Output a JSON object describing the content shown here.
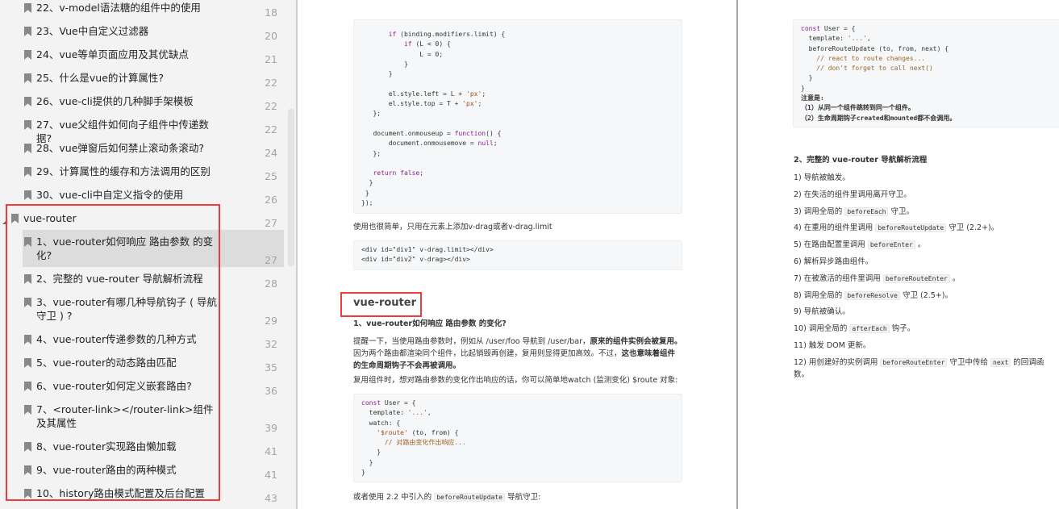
{
  "sidebar": {
    "items": [
      {
        "label": "22、v-model语法糖的组件中的使用",
        "page": "18"
      },
      {
        "label": "23、Vue中自定义过滤器",
        "page": "20"
      },
      {
        "label": "24、vue等单页面应用及其优缺点",
        "page": "21"
      },
      {
        "label": "25、什么是vue的计算属性?",
        "page": "22"
      },
      {
        "label": "26、vue-cli提供的几种脚手架模板",
        "page": "22"
      },
      {
        "label": "27、vue父组件如何向子组件中传递数据?",
        "page": "22"
      },
      {
        "label": "28、vue弹窗后如何禁止滚动条滚动?",
        "page": "24"
      },
      {
        "label": "29、计算属性的缓存和方法调用的区别",
        "page": "25"
      },
      {
        "label": "30、vue-cli中自定义指令的使用",
        "page": "26"
      },
      {
        "label": "vue-router",
        "page": "27"
      },
      {
        "label": "1、vue-router如何响应 路由参数 的变化?",
        "page": "27"
      },
      {
        "label": "2、完整的 vue-router 导航解析流程",
        "page": "28"
      },
      {
        "label": "3、vue-router有哪几种导航钩子 ( 导航守卫 ) ?",
        "page": "29"
      },
      {
        "label": "4、vue-router传递参数的几种方式",
        "page": "32"
      },
      {
        "label": "5、vue-router的动态路由匹配",
        "page": "35"
      },
      {
        "label": "6、vue-router如何定义嵌套路由?",
        "page": "36"
      },
      {
        "label": "7、<router-link></router-link>组件及其属性",
        "page": "39"
      },
      {
        "label": "8、vue-router实现路由懒加载",
        "page": "41"
      },
      {
        "label": "9、vue-router路由的两种模式",
        "page": "41"
      },
      {
        "label": "10、history路由模式配置及后台配置",
        "page": "43"
      }
    ]
  },
  "left_page": {
    "code1": [
      "       if (binding.modifiers.limit) {",
      "           if (L < 0) {",
      "               L = 0;",
      "           }",
      "       }",
      "",
      "       el.style.left = L + 'px';",
      "       el.style.top = T + 'px';",
      "   };",
      "",
      "   document.onmouseup = function() {",
      "       document.onmousemove = null;",
      "   };",
      "",
      "   return false;",
      "  }",
      " }",
      "});"
    ],
    "usage_text": "使用也很简单，只用在元素上添加v-drag或者v-drag.limit",
    "code2": [
      "<div id=\"div1\" v-drag.limit></div>",
      "<div id=\"div2\" v-drag></div>"
    ],
    "section_heading": "vue-router",
    "q1_title": "1、vue-router如何响应 路由参数 的变化?",
    "para1_a": "提醒一下，当使用路由参数时，例如从 /user/foo 导航到 /user/bar，",
    "para1_b": "原来的组件实例会被复用。",
    "para1_c": "因为两个路由都渲染同个组件，比起销毁再创建，复用则显得更加高效。不过，",
    "para1_d": "这也意味着组件的生命周期钩子不会再被调用。",
    "para2": "复用组件时，想对路由参数的变化作出响应的话，你可以简单地watch (监测变化) $route 对象:",
    "code3": [
      "const User = {",
      "  template: '...',",
      "  watch: {",
      "    '$route' (to, from) {",
      "      // 对路由变化作出响应...",
      "    }",
      "  }",
      "}"
    ],
    "para3_a": "或者使用 2.2 中引入的",
    "para3_code": "beforeRouteUpdate",
    "para3_b": "导航守卫:"
  },
  "right_page": {
    "code": [
      "const User = {",
      "  template: '...',",
      "  beforeRouteUpdate (to, from, next) {",
      "    // react to route changes...",
      "    // don't forget to call next()",
      "  }",
      "}"
    ],
    "notes": [
      "注意是:",
      "（1）从同一个组件跳转到同一个组件。",
      "（2）生命周期钩子created和mounted都不会调用。"
    ],
    "q2_title": "2、完整的 vue-router 导航解析流程",
    "steps": [
      {
        "pre": "1) 导航被触发。"
      },
      {
        "pre": "2) 在失活的组件里调用离开守卫。"
      },
      {
        "pre": "3) 调用全局的",
        "code": "beforeEach",
        "post": "守卫。"
      },
      {
        "pre": "4) 在重用的组件里调用",
        "code": "beforeRouteUpdate",
        "post": "守卫 (2.2+)。"
      },
      {
        "pre": "5) 在路由配置里调用",
        "code": "beforeEnter",
        "post": "。"
      },
      {
        "pre": "6) 解析异步路由组件。"
      },
      {
        "pre": "7) 在被激活的组件里调用",
        "code": "beforeRouteEnter",
        "post": "。"
      },
      {
        "pre": "8) 调用全局的",
        "code": "beforeResolve",
        "post": "守卫 (2.5+)。"
      },
      {
        "pre": "9) 导航被确认。"
      },
      {
        "pre": "10) 调用全局的",
        "code": "afterEach",
        "post": "钩子。"
      },
      {
        "pre": "11) 触发 DOM 更新。"
      },
      {
        "pre": "12) 用创建好的实例调用",
        "code": "beforeRouteEnter",
        "post": "守卫中传给",
        "code2": "next",
        "post2": "的回调函数。"
      }
    ]
  }
}
